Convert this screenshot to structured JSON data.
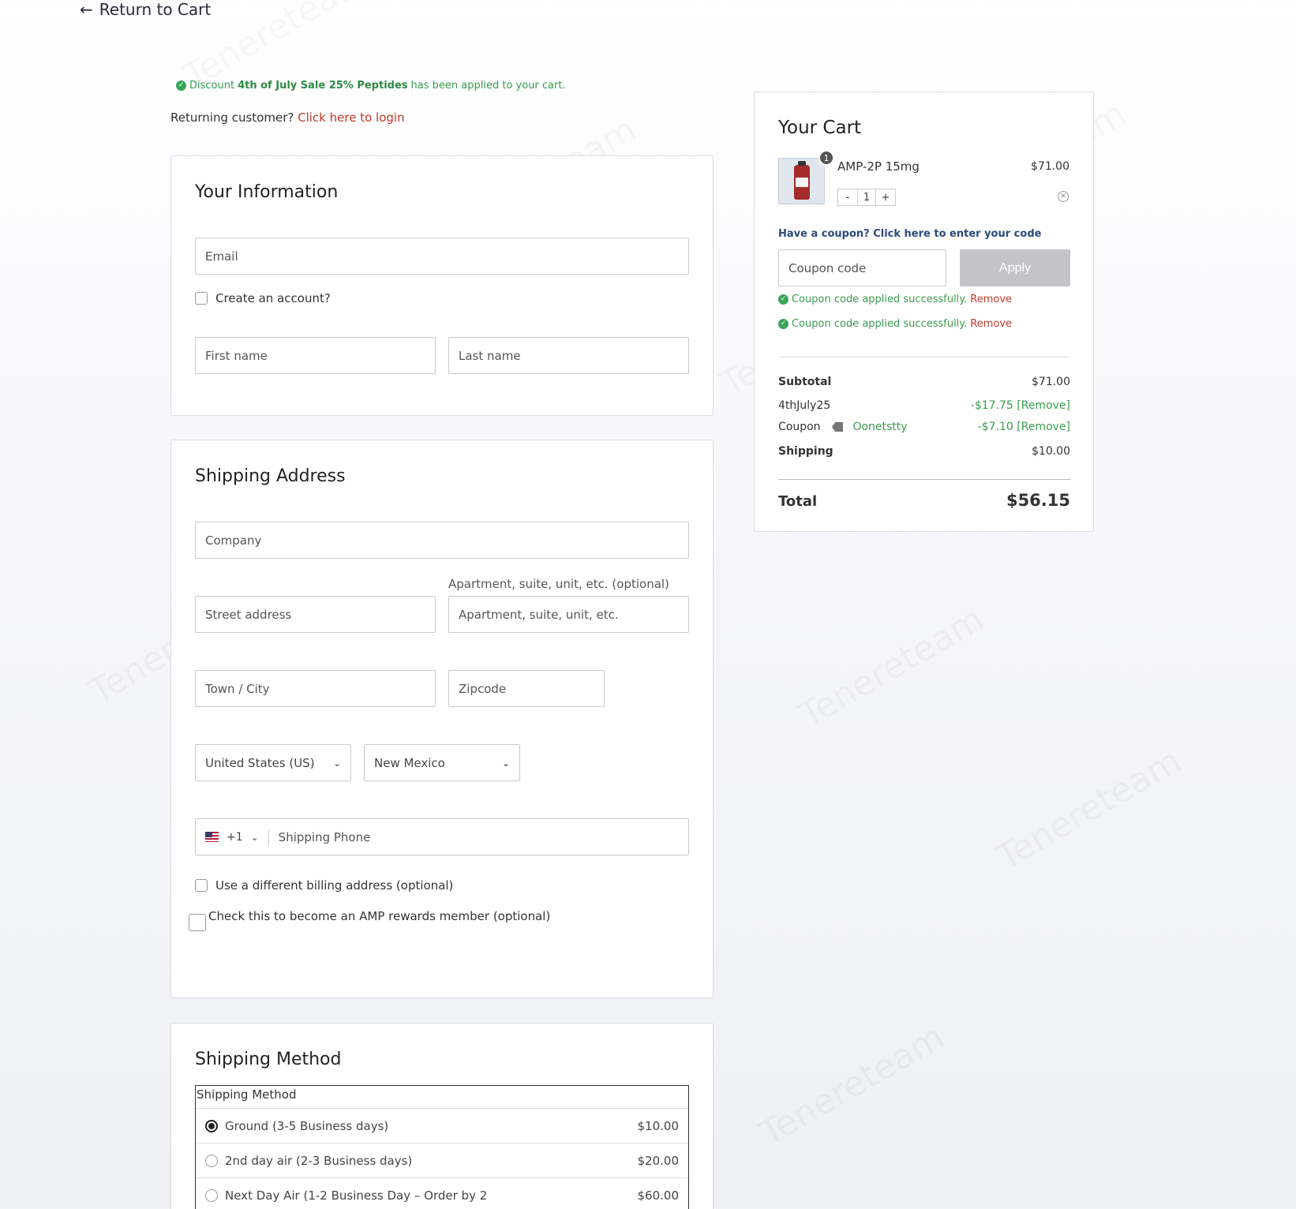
{
  "nav": {
    "return_label": "Return to Cart"
  },
  "discount_notice": {
    "prefix": "Discount",
    "name": "4th of July Sale 25% Peptides",
    "suffix": "has been applied to your cart."
  },
  "returning": {
    "prompt": "Returning customer?",
    "link": "Click here to login"
  },
  "your_information": {
    "title": "Your Information",
    "email_placeholder": "Email",
    "create_account_label": "Create an account?",
    "first_name_placeholder": "First name",
    "last_name_placeholder": "Last name"
  },
  "shipping_address": {
    "title": "Shipping Address",
    "company_placeholder": "Company",
    "apartment_label": "Apartment, suite, unit, etc. (optional)",
    "street_placeholder": "Street address",
    "apartment_placeholder": "Apartment, suite, unit, etc.",
    "city_placeholder": "Town / City",
    "zip_placeholder": "Zipcode",
    "country_value": "United States (US)",
    "state_value": "New Mexico",
    "phone_code": "+1",
    "phone_placeholder": "Shipping Phone",
    "billing_label": "Use a different billing address (optional)",
    "rewards_label": "Check this to become an AMP rewards member (optional)"
  },
  "shipping_method": {
    "title": "Shipping Method",
    "table_header": "Shipping Method",
    "options": [
      {
        "label": "Ground (3-5 Business days)",
        "price": "$10.00",
        "selected": true
      },
      {
        "label": "2nd day air (2-3 Business days)",
        "price": "$20.00",
        "selected": false
      },
      {
        "label": "Next Day Air (1-2 Business Day – Order by 2",
        "price": "$60.00",
        "selected": false
      }
    ]
  },
  "cart": {
    "title": "Your Cart",
    "item": {
      "name": "AMP-2P 15mg",
      "price": "$71.00",
      "badge": "1",
      "qty": "1",
      "minus": "-",
      "plus": "+"
    },
    "coupon_prompt": "Have a coupon? Click here to enter your code",
    "coupon_placeholder": "Coupon code",
    "apply_label": "Apply",
    "applied_messages": [
      {
        "text": "Coupon code applied successfully.",
        "remove": "Remove"
      },
      {
        "text": "Coupon code applied successfully.",
        "remove": "Remove"
      }
    ],
    "subtotal_label": "Subtotal",
    "subtotal_value": "$71.00",
    "discount1_label": "4thJuly25",
    "discount1_value": "-$17.75 [Remove]",
    "coupon_label": "Coupon",
    "coupon_name": "Oonetstty",
    "coupon_value": "-$7.10 [Remove]",
    "shipping_label": "Shipping",
    "shipping_value": "$10.00",
    "total_label": "Total",
    "total_value": "$56.15"
  },
  "colors": {
    "link_red": "#c0392b",
    "success_green": "#3a9b4f",
    "apply_gray": "#c3c3c8"
  }
}
